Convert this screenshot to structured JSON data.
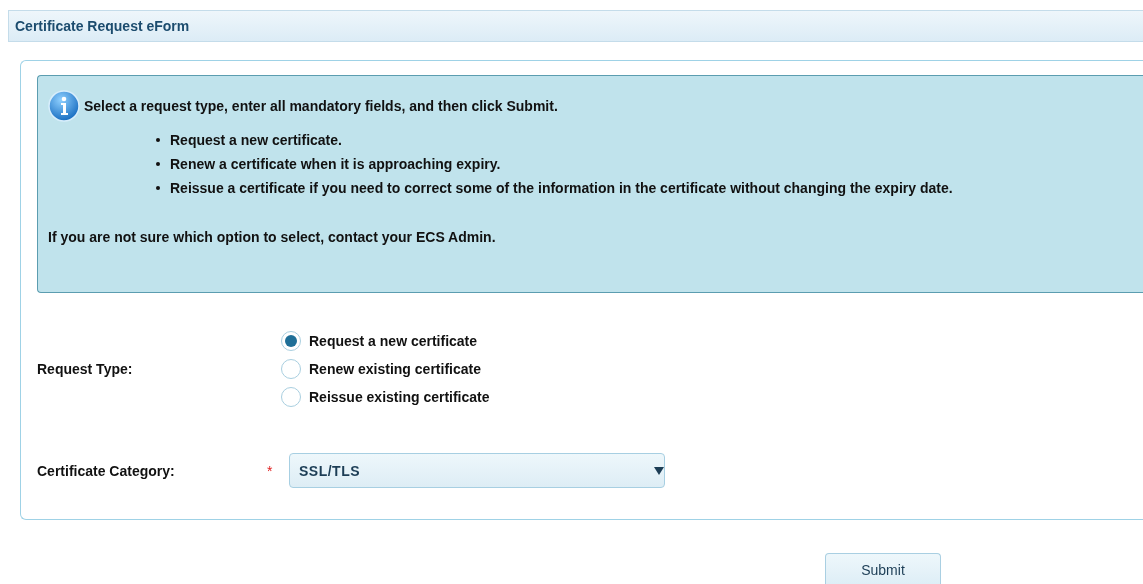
{
  "header": {
    "title": "Certificate Request eForm"
  },
  "info": {
    "intro": "Select a request type, enter all mandatory fields, and then click Submit.",
    "bullets": [
      "Request a new certificate.",
      "Renew a certificate when it is approaching expiry.",
      "Reissue a certificate if you need to correct some of the information in the certificate without changing the expiry date."
    ],
    "note": "If you are not sure which option to select, contact your ECS Admin."
  },
  "request_type": {
    "label": "Request Type:",
    "options": [
      {
        "label": "Request a new certificate",
        "selected": true
      },
      {
        "label": "Renew existing certificate",
        "selected": false
      },
      {
        "label": "Reissue existing certificate",
        "selected": false
      }
    ]
  },
  "category": {
    "label": "Certificate Category:",
    "required_mark": "*",
    "value": "SSL/TLS"
  },
  "submit": {
    "label": "Submit"
  }
}
